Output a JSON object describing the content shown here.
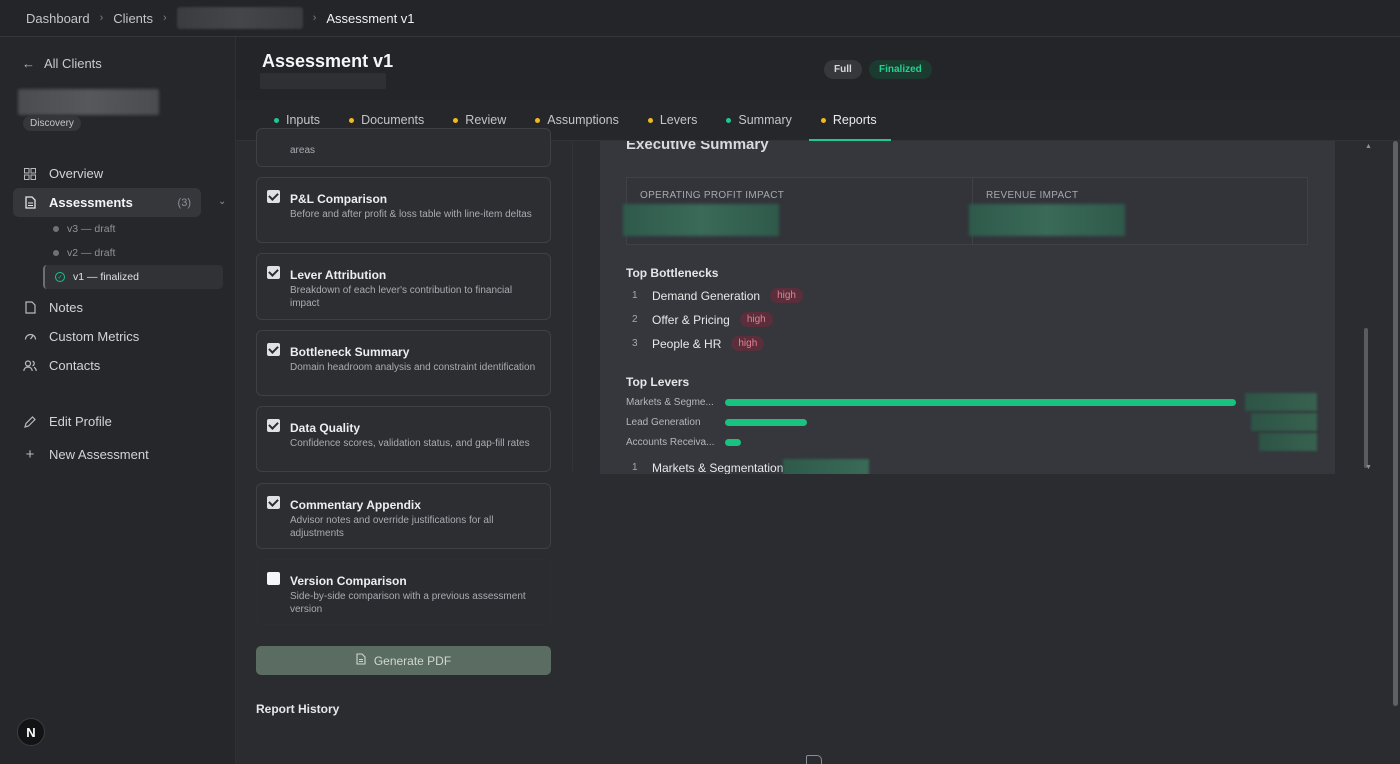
{
  "breadcrumb": {
    "dashboard": "Dashboard",
    "clients": "Clients",
    "current": "Assessment v1"
  },
  "sidebar": {
    "back_label": "All Clients",
    "client_badge": "Discovery",
    "items": [
      {
        "label": "Overview",
        "icon": "grid-icon"
      },
      {
        "label": "Assessments",
        "icon": "document-icon",
        "count": "(3)"
      }
    ],
    "versions": [
      {
        "label": "v3 — draft"
      },
      {
        "label": "v2 — draft"
      },
      {
        "label": "v1 — finalized"
      }
    ],
    "items2": [
      {
        "label": "Notes",
        "icon": "file-icon"
      },
      {
        "label": "Custom Metrics",
        "icon": "gauge-icon"
      },
      {
        "label": "Contacts",
        "icon": "users-icon"
      }
    ],
    "edit_profile": "Edit Profile",
    "new_assessment": "New Assessment",
    "avatar_letter": "N"
  },
  "header": {
    "title": "Assessment v1",
    "pill_full": "Full",
    "pill_finalized": "Finalized"
  },
  "tabs": [
    {
      "label": "Inputs",
      "dot": "#1ec88f"
    },
    {
      "label": "Documents",
      "dot": "#f0b91e"
    },
    {
      "label": "Review",
      "dot": "#f0b91e"
    },
    {
      "label": "Assumptions",
      "dot": "#f0b91e"
    },
    {
      "label": "Levers",
      "dot": "#f0b91e"
    },
    {
      "label": "Summary",
      "dot": "#1ec88f"
    },
    {
      "label": "Reports",
      "dot": "#f0b91e"
    }
  ],
  "options": {
    "partial_desc": "areas",
    "list": [
      {
        "title": "P&L Comparison",
        "desc": "Before and after profit & loss table with line-item deltas",
        "checked": true
      },
      {
        "title": "Lever Attribution",
        "desc": "Breakdown of each lever's contribution to financial impact",
        "checked": true
      },
      {
        "title": "Bottleneck Summary",
        "desc": "Domain headroom analysis and constraint identification",
        "checked": true
      },
      {
        "title": "Data Quality",
        "desc": "Confidence scores, validation status, and gap-fill rates",
        "checked": true
      },
      {
        "title": "Commentary Appendix",
        "desc": "Advisor notes and override justifications for all adjustments",
        "checked": true
      },
      {
        "title": "Version Comparison",
        "desc": "Side-by-side comparison with a previous assessment version",
        "checked": false
      }
    ],
    "generate_label": "Generate PDF",
    "report_history": "Report History"
  },
  "preview": {
    "title": "Executive Summary",
    "metric1_label": "OPERATING PROFIT IMPACT",
    "metric2_label": "REVENUE IMPACT",
    "bottlenecks_title": "Top Bottlenecks",
    "bottlenecks": [
      {
        "num": "1",
        "name": "Demand Generation",
        "tag": "high"
      },
      {
        "num": "2",
        "name": "Offer & Pricing",
        "tag": "high"
      },
      {
        "num": "3",
        "name": "People & HR",
        "tag": "high"
      }
    ],
    "levers_title": "Top Levers",
    "levers": [
      {
        "name": "Markets & Segme...",
        "value": 1.0
      },
      {
        "name": "Lead Generation",
        "value": 0.16
      },
      {
        "name": "Accounts Receiva...",
        "value": 0.03
      }
    ],
    "bottom_num": "1",
    "bottom_name": "Markets & Segmentation"
  }
}
